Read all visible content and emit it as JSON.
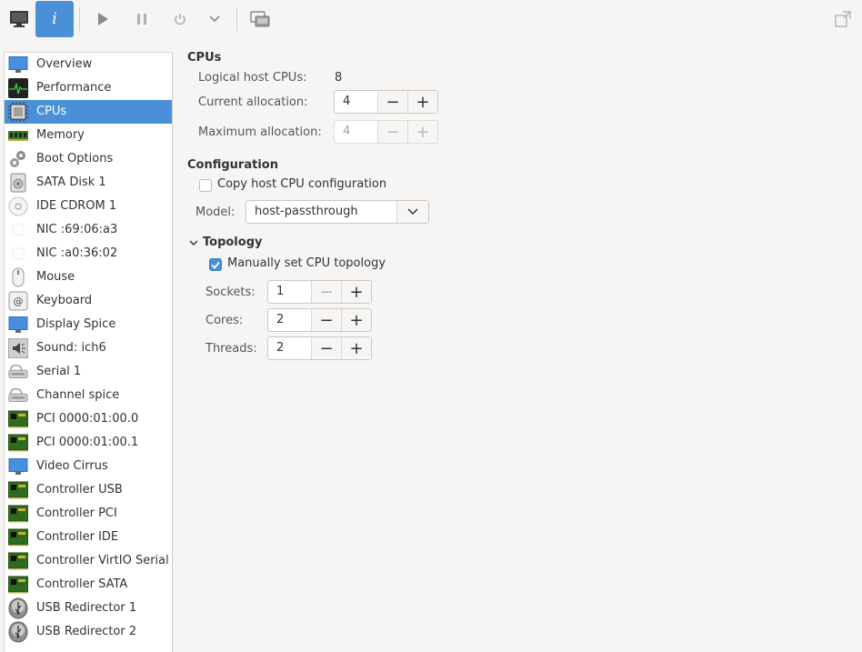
{
  "toolbar": {
    "buttons": [
      {
        "icon": "monitor-icon",
        "active": false
      },
      {
        "icon": "info-icon",
        "label": "i",
        "active": true
      },
      {
        "icon": "play-icon",
        "active": false
      },
      {
        "icon": "pause-icon",
        "active": false
      },
      {
        "icon": "power-icon",
        "active": false
      },
      {
        "icon": "chevron-down-icon",
        "active": false
      },
      {
        "icon": "screens-icon",
        "active": false
      },
      {
        "icon": "fullscreen-icon",
        "active": false
      }
    ]
  },
  "sidebar": {
    "items": [
      {
        "label": "Overview",
        "icon": "monitor-icon"
      },
      {
        "label": "Performance",
        "icon": "performance-icon"
      },
      {
        "label": "CPUs",
        "icon": "cpu-icon",
        "selected": true
      },
      {
        "label": "Memory",
        "icon": "memory-icon"
      },
      {
        "label": "Boot Options",
        "icon": "gears-icon"
      },
      {
        "label": "SATA Disk 1",
        "icon": "disk-icon"
      },
      {
        "label": "IDE CDROM 1",
        "icon": "cdrom-icon"
      },
      {
        "label": "NIC :69:06:a3",
        "icon": "nic-icon"
      },
      {
        "label": "NIC :a0:36:02",
        "icon": "nic-icon"
      },
      {
        "label": "Mouse",
        "icon": "mouse-icon"
      },
      {
        "label": "Keyboard",
        "icon": "keyboard-icon"
      },
      {
        "label": "Display Spice",
        "icon": "monitor-icon"
      },
      {
        "label": "Sound: ich6",
        "icon": "sound-icon"
      },
      {
        "label": "Serial 1",
        "icon": "serial-icon"
      },
      {
        "label": "Channel spice",
        "icon": "serial-icon"
      },
      {
        "label": "PCI 0000:01:00.0",
        "icon": "pci-card-icon"
      },
      {
        "label": "PCI 0000:01:00.1",
        "icon": "pci-card-icon"
      },
      {
        "label": "Video Cirrus",
        "icon": "monitor-icon"
      },
      {
        "label": "Controller USB",
        "icon": "pci-card-icon"
      },
      {
        "label": "Controller PCI",
        "icon": "pci-card-icon"
      },
      {
        "label": "Controller IDE",
        "icon": "pci-card-icon"
      },
      {
        "label": "Controller VirtIO Serial",
        "icon": "pci-card-icon"
      },
      {
        "label": "Controller SATA",
        "icon": "pci-card-icon"
      },
      {
        "label": "USB Redirector 1",
        "icon": "usb-icon"
      },
      {
        "label": "USB Redirector 2",
        "icon": "usb-icon"
      }
    ]
  },
  "cpus": {
    "title": "CPUs",
    "logical_label": "Logical host CPUs:",
    "logical_value": "8",
    "current_label": "Current allocation:",
    "current_value": "4",
    "max_label": "Maximum allocation:",
    "max_value": "4"
  },
  "configuration": {
    "title": "Configuration",
    "copy_host_label": "Copy host CPU configuration",
    "copy_host_checked": false,
    "model_label": "Model:",
    "model_value": "host-passthrough"
  },
  "topology": {
    "title": "Topology",
    "manual_label": "Manually set CPU topology",
    "manual_checked": true,
    "sockets_label": "Sockets:",
    "sockets_value": "1",
    "cores_label": "Cores:",
    "cores_value": "2",
    "threads_label": "Threads:",
    "threads_value": "2"
  },
  "symbols": {
    "minus": "−",
    "plus": "+"
  },
  "colors": {
    "accent": "#4a90d9",
    "background": "#f6f5f4"
  }
}
